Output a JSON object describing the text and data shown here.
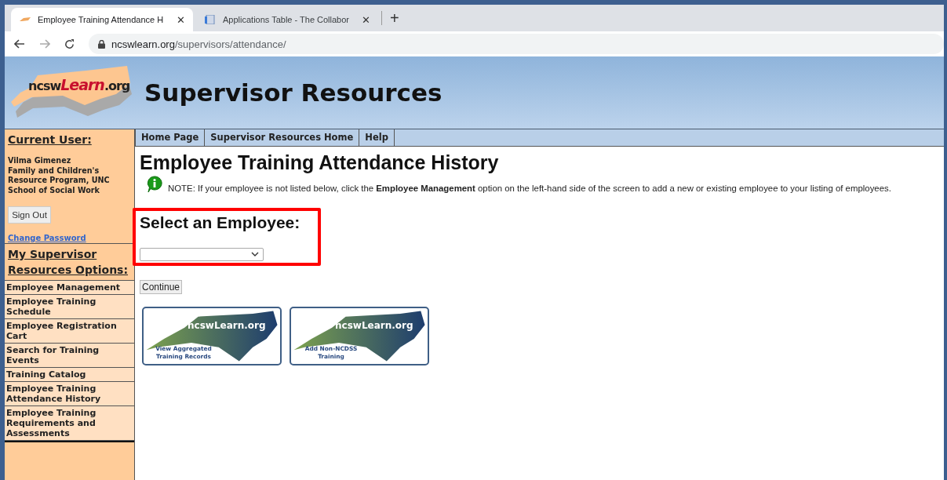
{
  "browser": {
    "tabs": [
      {
        "title": "Employee Training Attendance H",
        "close": "✕",
        "selected": true
      },
      {
        "title": "Applications Table - The Collabor",
        "close": "✕",
        "selected": false
      }
    ],
    "new_tab": "+",
    "url": {
      "host": "ncswlearn.org",
      "path": "/supervisors/attendance/"
    }
  },
  "header": {
    "logo": [
      "ncsw",
      "Learn",
      ".org"
    ],
    "title": "Supervisor Resources"
  },
  "sidebar": {
    "user_heading": "Current User:",
    "user_lines": [
      "Vilma Gimenez",
      "Family and Children's",
      "Resource Program, UNC",
      "School of Social Work"
    ],
    "sign_out": "Sign Out",
    "change_password": "Change Password",
    "options_heading": "My Supervisor Resources Options:",
    "items": [
      "Employee Management",
      "Employee Training Schedule",
      "Employee Registration Cart",
      "Search for Training Events",
      "Training Catalog",
      "Employee Training Attendance History",
      "Employee Training Requirements and Assessments"
    ]
  },
  "nav": [
    "Home Page",
    "Supervisor Resources Home",
    "Help"
  ],
  "main": {
    "title": "Employee Training Attendance History",
    "note": "NOTE: If your employee is not listed below, click the **Employee Management** option on the left-hand side of the screen to add a new or existing employee to your listing of employees.",
    "select_label": "Select an Employee:",
    "continue": "Continue",
    "tiles": [
      {
        "brand": "ncswLearn.org",
        "caption": "View Aggregated Training Records"
      },
      {
        "brand": "ncswLearn.org",
        "caption": "Add Non-NCDSS Training"
      }
    ]
  }
}
